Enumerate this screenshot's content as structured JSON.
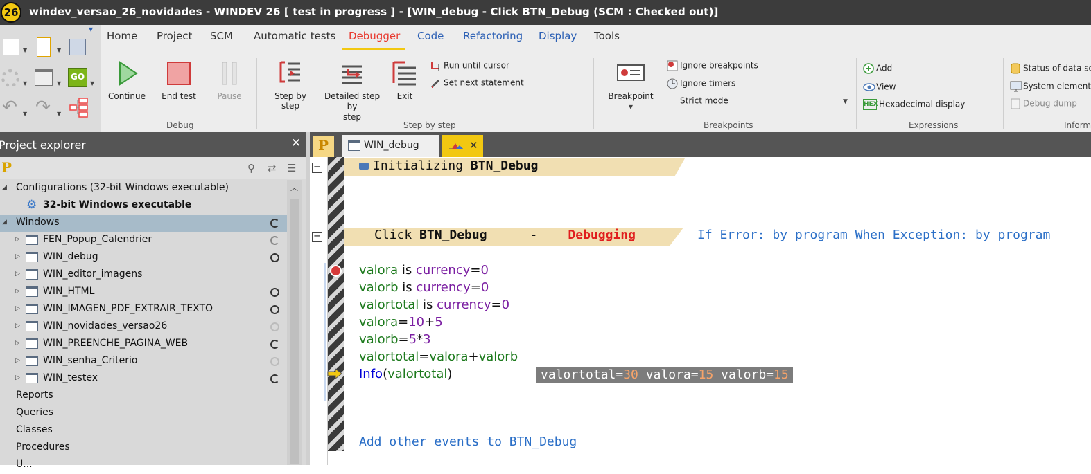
{
  "window": {
    "logo_text": "26",
    "title": "windev_versao_26_novidades - WINDEV 26 [ test in progress ] - [WIN_debug - Click BTN_Debug (SCM : Checked out)]"
  },
  "ribbon_tabs": [
    "Home",
    "Project",
    "SCM",
    "Automatic tests",
    "Debugger",
    "Code",
    "Refactoring",
    "Display",
    "Tools"
  ],
  "active_ribbon_tab": "Debugger",
  "debug_group": {
    "label": "Debug",
    "continue": "Continue",
    "end_test": "End test",
    "pause": "Pause"
  },
  "step_group": {
    "label": "Step by step",
    "step_by_step": "Step by step",
    "detailed_step_1": "Detailed step by",
    "detailed_step_2": "step",
    "exit": "Exit",
    "run_until_cursor": "Run until cursor",
    "set_next_statement": "Set next statement"
  },
  "breakpoints_group": {
    "label": "Breakpoints",
    "breakpoint": "Breakpoint",
    "ignore_breakpoints": "Ignore breakpoints",
    "ignore_timers": "Ignore timers",
    "strict_mode": "Strict mode"
  },
  "expressions_group": {
    "label": "Expressions",
    "add": "Add",
    "view": "View",
    "hex_display": "Hexadecimal display",
    "hex_icon": "HEX"
  },
  "info_group": {
    "label": "Inform",
    "status_data": "Status of data sou",
    "system_elements": "System elements",
    "debug_dump": "Debug dump"
  },
  "project_explorer": {
    "title": "Project explorer",
    "logo": "P",
    "items": [
      {
        "label": "Configurations (32-bit Windows executable)",
        "level": 0,
        "expander": "◢",
        "status": ""
      },
      {
        "label": "32-bit Windows executable",
        "level": 1,
        "expander": "",
        "status": "",
        "bold": true
      },
      {
        "label": "Windows",
        "level": 0,
        "expander": "◢",
        "status": "half",
        "selected": true
      },
      {
        "label": "FEN_Popup_Calendrier",
        "level": 1,
        "expander": "▷",
        "status": "half-light"
      },
      {
        "label": "WIN_debug",
        "level": 1,
        "expander": "▷",
        "status": "full"
      },
      {
        "label": "WIN_editor_imagens",
        "level": 1,
        "expander": "▷",
        "status": ""
      },
      {
        "label": "WIN_HTML",
        "level": 1,
        "expander": "▷",
        "status": "full"
      },
      {
        "label": "WIN_IMAGEN_PDF_EXTRAIR_TEXTO",
        "level": 1,
        "expander": "▷",
        "status": "full"
      },
      {
        "label": "WIN_novidades_versao26",
        "level": 1,
        "expander": "▷",
        "status": "light"
      },
      {
        "label": "WIN_PREENCHE_PAGINA_WEB",
        "level": 1,
        "expander": "▷",
        "status": "half"
      },
      {
        "label": "WIN_senha_Criterio",
        "level": 1,
        "expander": "▷",
        "status": "light"
      },
      {
        "label": "WIN_testex",
        "level": 1,
        "expander": "▷",
        "status": "half"
      },
      {
        "label": "Reports",
        "level": 0,
        "expander": "",
        "status": ""
      },
      {
        "label": "Queries",
        "level": 0,
        "expander": "",
        "status": ""
      },
      {
        "label": "Classes",
        "level": 0,
        "expander": "",
        "status": ""
      },
      {
        "label": "Procedures",
        "level": 0,
        "expander": "",
        "status": ""
      },
      {
        "label": "U...",
        "level": 0,
        "expander": "",
        "status": ""
      }
    ]
  },
  "doc_tabs": {
    "project_tab": "P",
    "window_tab": "WIN_debug"
  },
  "editor": {
    "init_event": "Initializing ",
    "init_control": "BTN_Debug",
    "click_event": "Click ",
    "click_control": "BTN_Debug",
    "dash": "-",
    "debugging": "Debugging",
    "error_info": "If Error: by program When Exception: by program",
    "code": [
      [
        {
          "t": "valora",
          "c": "var"
        },
        {
          "t": " is ",
          "c": ""
        },
        {
          "t": "currency",
          "c": "typ"
        },
        {
          "t": "=",
          "c": ""
        },
        {
          "t": "0",
          "c": "num"
        }
      ],
      [
        {
          "t": "valorb",
          "c": "var"
        },
        {
          "t": " is ",
          "c": ""
        },
        {
          "t": "currency",
          "c": "typ"
        },
        {
          "t": "=",
          "c": ""
        },
        {
          "t": "0",
          "c": "num"
        }
      ],
      [
        {
          "t": "valortotal",
          "c": "var"
        },
        {
          "t": " is ",
          "c": ""
        },
        {
          "t": "currency",
          "c": "typ"
        },
        {
          "t": "=",
          "c": ""
        },
        {
          "t": "0",
          "c": "num"
        }
      ],
      [
        {
          "t": "valora",
          "c": "var"
        },
        {
          "t": "=",
          "c": ""
        },
        {
          "t": "10",
          "c": "num"
        },
        {
          "t": "+",
          "c": ""
        },
        {
          "t": "5",
          "c": "num"
        }
      ],
      [
        {
          "t": "valorb",
          "c": "var"
        },
        {
          "t": "=",
          "c": ""
        },
        {
          "t": "5",
          "c": "num"
        },
        {
          "t": "*",
          "c": ""
        },
        {
          "t": "3",
          "c": "num"
        }
      ],
      [
        {
          "t": "valortotal",
          "c": "var"
        },
        {
          "t": "=",
          "c": ""
        },
        {
          "t": "valora",
          "c": "var"
        },
        {
          "t": "+",
          "c": ""
        },
        {
          "t": "valorb",
          "c": "var"
        }
      ],
      [
        {
          "t": "Info",
          "c": "kw"
        },
        {
          "t": "(",
          "c": ""
        },
        {
          "t": "valortotal",
          "c": "var"
        },
        {
          "t": ")",
          "c": ""
        }
      ]
    ],
    "tooltip": [
      {
        "name": "valortotal=",
        "value": "30"
      },
      {
        "name": " valora=",
        "value": "15"
      },
      {
        "name": " valorb=",
        "value": "15"
      }
    ],
    "add_events": "Add other events to BTN_Debug"
  }
}
